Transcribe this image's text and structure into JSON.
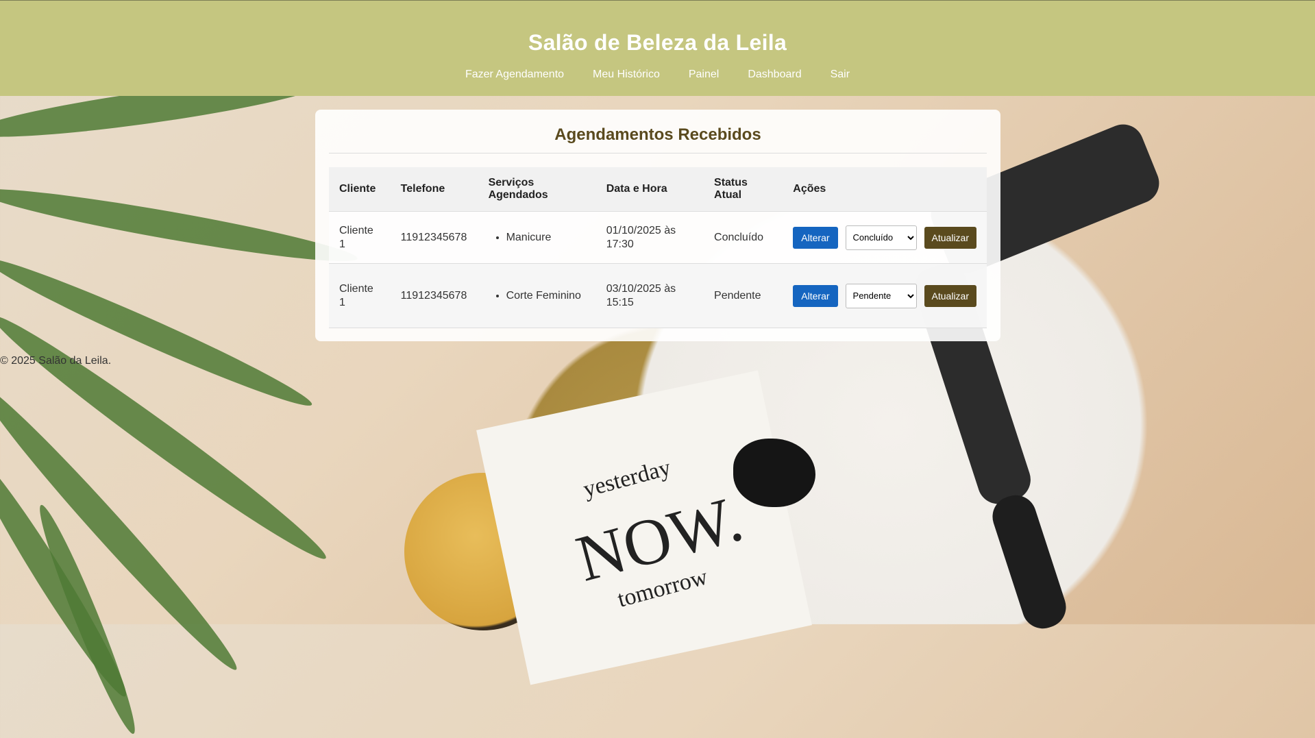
{
  "header": {
    "title": "Salão de Beleza da Leila",
    "nav": [
      {
        "label": "Fazer Agendamento"
      },
      {
        "label": "Meu Histórico"
      },
      {
        "label": "Painel"
      },
      {
        "label": "Dashboard"
      },
      {
        "label": "Sair"
      }
    ]
  },
  "main": {
    "heading": "Agendamentos Recebidos",
    "columns": [
      "Cliente",
      "Telefone",
      "Serviços Agendados",
      "Data e Hora",
      "Status Atual",
      "Ações"
    ],
    "rows": [
      {
        "cliente": "Cliente 1",
        "telefone": "11912345678",
        "servicos": [
          "Manicure"
        ],
        "data_hora": "01/10/2025 às 17:30",
        "status": "Concluído",
        "select_value": "Concluído",
        "alterar_label": "Alterar",
        "atualizar_label": "Atualizar"
      },
      {
        "cliente": "Cliente 1",
        "telefone": "11912345678",
        "servicos": [
          "Corte Feminino"
        ],
        "data_hora": "03/10/2025 às 15:15",
        "status": "Pendente",
        "select_value": "Pendente",
        "alterar_label": "Alterar",
        "atualizar_label": "Atualizar"
      }
    ]
  },
  "footer": {
    "text": "© 2025 Salão da Leila."
  },
  "background": {
    "note_words": [
      "yesterday",
      "NOW.",
      "tomorrow"
    ]
  },
  "colors": {
    "header_bg": "#c5c680",
    "heading": "#5a4a1e",
    "primary_button": "#1565c0",
    "secondary_button": "#5a4a1e"
  }
}
